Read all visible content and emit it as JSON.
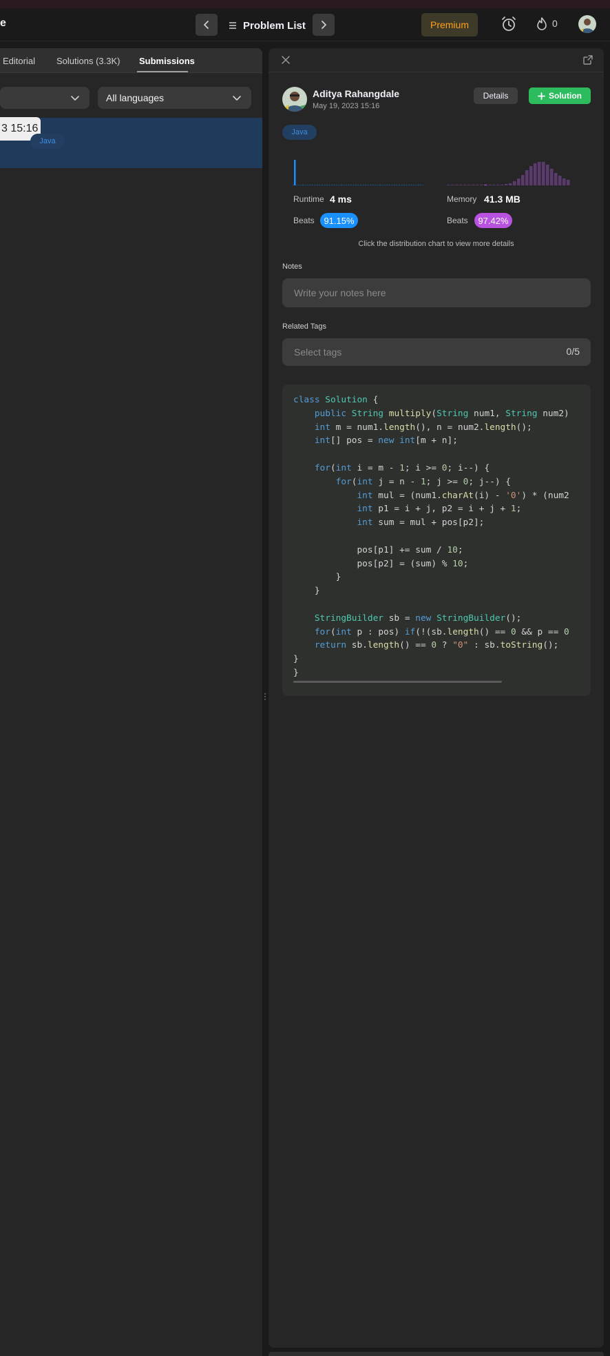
{
  "nav": {
    "title_fragment": "e",
    "problem_list": "Problem List",
    "premium": "Premium",
    "streak_count": "0"
  },
  "left": {
    "tabs": [
      {
        "label": "Editorial"
      },
      {
        "label": "Solutions (3.3K)"
      },
      {
        "label": "Submissions",
        "active": true
      }
    ],
    "language_filter": "All languages",
    "tooltip": "3 15:16",
    "row_language": "Java"
  },
  "right": {
    "author": "Aditya Rahangdale",
    "date": "May 19, 2023 15:16",
    "details_label": "Details",
    "solution_label": "Solution",
    "language": "Java",
    "runtime": {
      "label": "Runtime",
      "value": "4 ms",
      "beats_label": "Beats",
      "beats": "91.15%"
    },
    "memory": {
      "label": "Memory",
      "value": "41.3 MB",
      "beats_label": "Beats",
      "beats": "97.42%"
    },
    "hint": "Click the distribution chart to view more details",
    "notes_label": "Notes",
    "notes_placeholder": "Write your notes here",
    "tags_label": "Related Tags",
    "tags_placeholder": "Select tags",
    "tags_count": "0/5"
  },
  "colors": {
    "accent_green": "#2cbb5d",
    "premium_orange": "#ffa116",
    "runtime_blue": "#1a90ff",
    "memory_purple": "#b952e0"
  }
}
